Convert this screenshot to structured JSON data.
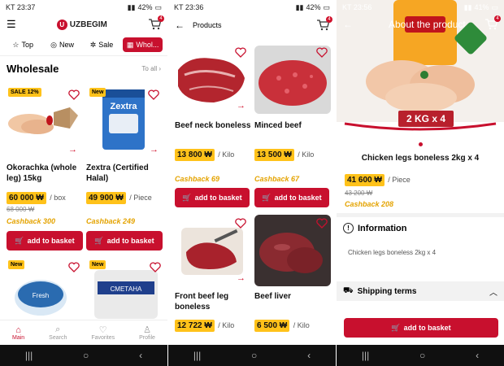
{
  "s1": {
    "status": {
      "time": "KT 23:37",
      "battery": "42%"
    },
    "logo": "UZBEGIM",
    "cart_badge": "4",
    "tabs": [
      "Top",
      "New",
      "Sale",
      "Whol..."
    ],
    "section_title": "Wholesale",
    "to_all": "To all",
    "products": [
      {
        "tag": "SALE 12%",
        "name": "Okorachka (whole leg) 15kg",
        "price": "60 000 ₩",
        "unit": "/ box",
        "old": "68 000 ₩",
        "cashback": "Cashback 300",
        "button": "add to basket"
      },
      {
        "tag": "New",
        "name": "Zextra (Certified Halal)",
        "price": "49 900 ₩",
        "unit": "/ Piece",
        "cashback": "Cashback 249",
        "button": "add to basket"
      }
    ],
    "tag3": "New",
    "tag4": "New",
    "bottom_nav": [
      "Main",
      "Search",
      "Favorites",
      "Profile"
    ]
  },
  "s2": {
    "status": {
      "time": "KT 23:36",
      "battery": "42%"
    },
    "title": "Products",
    "cart_badge": "4",
    "products": [
      {
        "name": "Beef neck boneless",
        "price": "13 800 ₩",
        "unit": "/ Kilo",
        "cashback": "Cashback 69",
        "button": "add to basket"
      },
      {
        "name": "Minced beef",
        "price": "13 500 ₩",
        "unit": "/ Kilo",
        "cashback": "Cashback 67",
        "button": "add to basket"
      },
      {
        "name": "Front beef leg boneless",
        "price": "12 722 ₩",
        "unit": "/ Kilo"
      },
      {
        "name": "Beef liver",
        "price": "6 500 ₩",
        "unit": "/ Kilo"
      }
    ]
  },
  "s3": {
    "status": {
      "time": "KT 23:56",
      "battery": "41%"
    },
    "title": "About the product",
    "cart_badge": "4",
    "image_caption": "2 KG x 4",
    "name": "Chicken legs boneless 2kg x 4",
    "price": "41 600 ₩",
    "unit": "/ Piece",
    "old": "43 200 ₩",
    "cashback": "Cashback 208",
    "info_title": "Information",
    "info_text": "Chicken legs boneless 2kg x 4",
    "shipping_title": "Shipping terms",
    "button": "add to basket"
  },
  "colors": {
    "accent": "#c8102e",
    "price_bg": "#ffc21a"
  }
}
